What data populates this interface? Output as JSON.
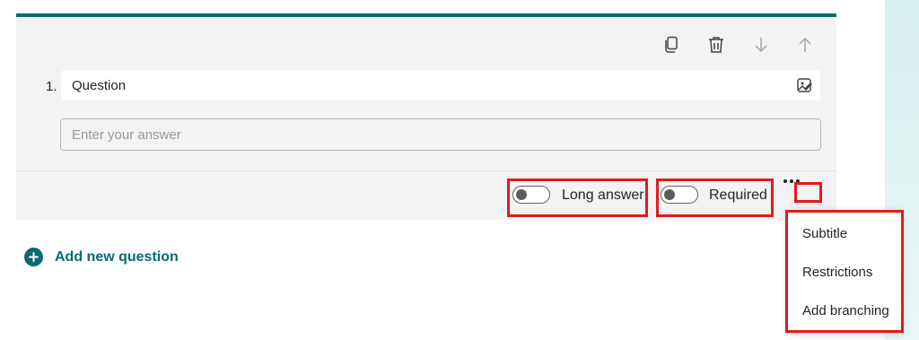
{
  "question": {
    "number": "1.",
    "title": "Question",
    "answer_placeholder": "Enter your answer"
  },
  "toolbar": {
    "icons": [
      "copy-icon",
      "delete-icon",
      "move-down-icon",
      "move-up-icon"
    ]
  },
  "options": {
    "long_answer_label": "Long answer",
    "long_answer_on": false,
    "required_label": "Required",
    "required_on": false
  },
  "add_question": {
    "label": "Add new question"
  },
  "more_menu": {
    "items": [
      "Subtitle",
      "Restrictions",
      "Add branching"
    ]
  },
  "colors": {
    "accent": "#0b6a6e",
    "highlight": "#e01b1b",
    "card_bg": "#f3f3f3"
  }
}
